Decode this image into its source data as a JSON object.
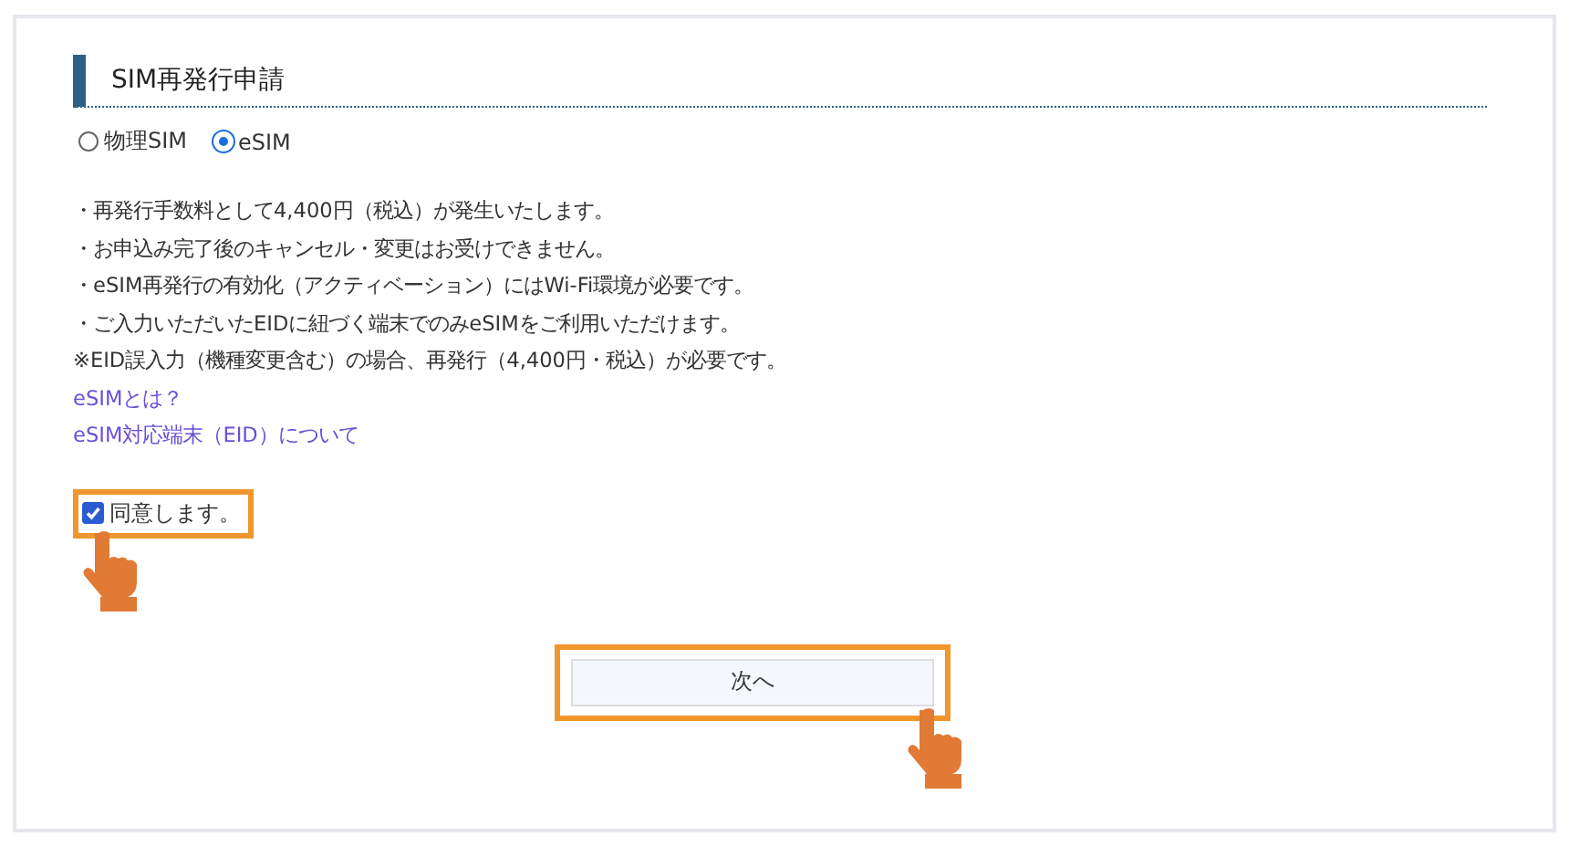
{
  "section": {
    "title": "SIM再発行申請"
  },
  "sim_types": [
    {
      "label": "物理SIM",
      "selected": false
    },
    {
      "label": "eSIM",
      "selected": true
    }
  ],
  "notes": [
    "・再発行手数料として4,400円（税込）が発生いたします。",
    "・お申込み完了後のキャンセル・変更はお受けできません。",
    "・eSIM再発行の有効化（アクティベーション）にはWi-Fi環境が必要です。",
    "・ご入力いただいたEIDに紐づく端末でのみeSIMをご利用いただけます。",
    "※EID誤入力（機種変更含む）の場合、再発行（4,400円・税込）が必要です。"
  ],
  "links": [
    "eSIMとは？",
    "eSIM対応端末（EID）について"
  ],
  "agree": {
    "label": "同意します。",
    "checked": true
  },
  "next_button": {
    "label": "次へ"
  }
}
